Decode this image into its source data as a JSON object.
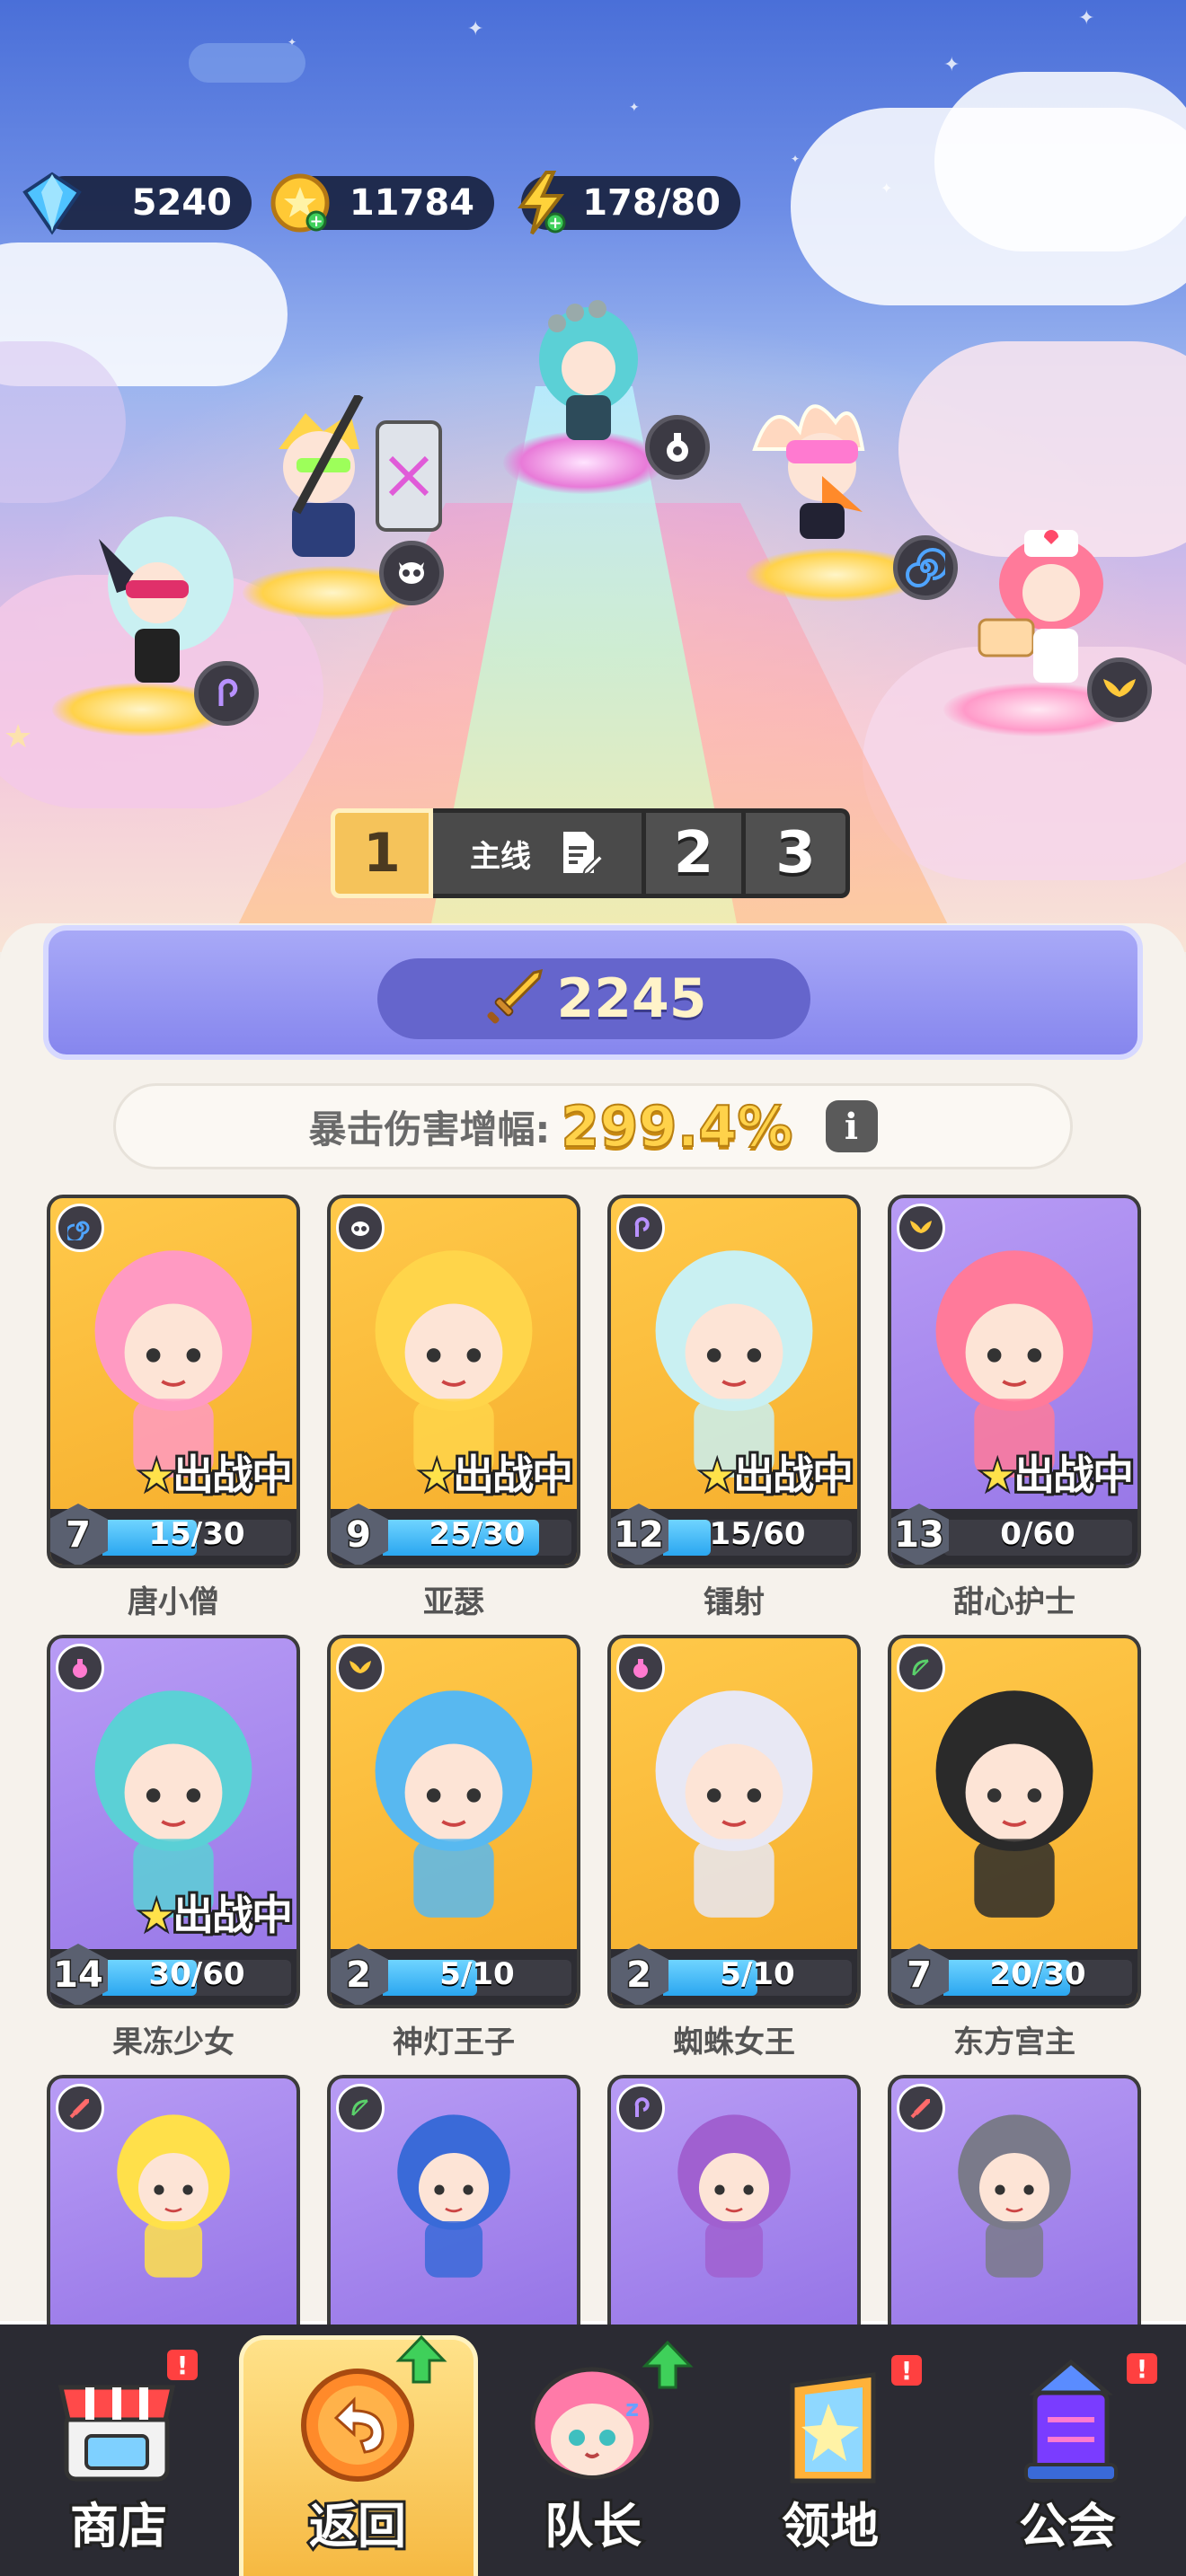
{
  "resources": {
    "gems": "5240",
    "coins": "11784",
    "energy": "178/80"
  },
  "chapter_tabs": [
    {
      "label": "1",
      "selected": true
    },
    {
      "label": "主线"
    },
    {
      "label": "2"
    },
    {
      "label": "3"
    }
  ],
  "power": "2245",
  "crit": {
    "label": "暴击伤害增幅:",
    "value": "299.4%",
    "info_icon": "i"
  },
  "deploy_text": "出战中",
  "heroes": [
    {
      "name": "唐小僧",
      "level": "7",
      "progress": "15/30",
      "fraction": 0.5,
      "deployed": true,
      "bg": "gold",
      "class_icon": "spiral-icon"
    },
    {
      "name": "亚瑟",
      "level": "9",
      "progress": "25/30",
      "fraction": 0.83,
      "deployed": true,
      "bg": "gold",
      "class_icon": "skull-icon"
    },
    {
      "name": "镭射",
      "level": "12",
      "progress": "15/60",
      "fraction": 0.25,
      "deployed": true,
      "bg": "gold",
      "class_icon": "hook-icon"
    },
    {
      "name": "甜心护士",
      "level": "13",
      "progress": "0/60",
      "fraction": 0,
      "deployed": true,
      "bg": "violet",
      "class_icon": "wings-icon"
    },
    {
      "name": "果冻少女",
      "level": "14",
      "progress": "30/60",
      "fraction": 0.5,
      "deployed": true,
      "bg": "violet",
      "class_icon": "potion-icon"
    },
    {
      "name": "神灯王子",
      "level": "2",
      "progress": "5/10",
      "fraction": 0.5,
      "deployed": false,
      "bg": "gold",
      "class_icon": "wings-icon"
    },
    {
      "name": "蜘蛛女王",
      "level": "2",
      "progress": "5/10",
      "fraction": 0.5,
      "deployed": false,
      "bg": "gold",
      "class_icon": "potion-icon"
    },
    {
      "name": "东方宫主",
      "level": "7",
      "progress": "20/30",
      "fraction": 0.67,
      "deployed": false,
      "bg": "gold",
      "class_icon": "bow-icon"
    },
    {
      "bg": "violet",
      "class_icon": "sword-icon"
    },
    {
      "bg": "violet",
      "class_icon": "bow-icon"
    },
    {
      "bg": "violet",
      "class_icon": "hook-icon"
    },
    {
      "bg": "violet",
      "class_icon": "sword-icon"
    }
  ],
  "nav": [
    {
      "label": "商店",
      "alert": "!"
    },
    {
      "label": "返回",
      "active": true
    },
    {
      "label": "队长"
    },
    {
      "label": "领地",
      "alert": "!"
    },
    {
      "label": "公会",
      "alert": "!"
    }
  ],
  "colors": {
    "gold_card": "#f5ac2a",
    "violet_card": "#9473e6",
    "progress": "#2aa6f0",
    "alert": "#ff4040"
  }
}
